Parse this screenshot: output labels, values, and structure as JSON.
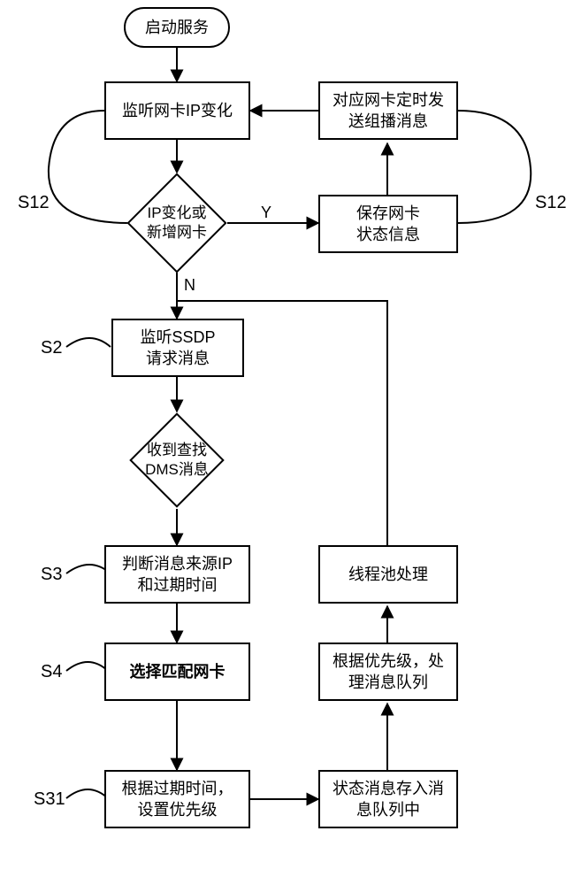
{
  "chart_data": {
    "type": "flowchart",
    "title": "",
    "nodes": [
      {
        "id": "start",
        "kind": "terminator",
        "label": "启动服务"
      },
      {
        "id": "p_listen_ip",
        "kind": "process",
        "label": "监听网卡IP变化",
        "tag": "S12"
      },
      {
        "id": "d_ip_change",
        "kind": "decision",
        "label": "IP变化或\n新增网卡"
      },
      {
        "id": "p_save_state",
        "kind": "process",
        "label": "保存网卡\n状态信息",
        "tag": "S12"
      },
      {
        "id": "p_timed_multicast",
        "kind": "process",
        "label": "对应网卡定时发\n送组播消息"
      },
      {
        "id": "p_listen_ssdp",
        "kind": "process",
        "label": "监听SSDP\n请求消息",
        "tag": "S2"
      },
      {
        "id": "d_recv_dms",
        "kind": "decision",
        "label": "收到查找\nDMS消息"
      },
      {
        "id": "p_judge",
        "kind": "process",
        "label": "判断消息来源IP\n和过期时间",
        "tag": "S3"
      },
      {
        "id": "p_select_nic",
        "kind": "process",
        "label": "选择匹配网卡",
        "tag": "S4",
        "bold": true
      },
      {
        "id": "p_set_priority",
        "kind": "process",
        "label": "根据过期时间，\n设置优先级",
        "tag": "S31"
      },
      {
        "id": "p_enqueue",
        "kind": "process",
        "label": "状态消息存入消\n息队列中"
      },
      {
        "id": "p_by_priority",
        "kind": "process",
        "label": "根据优先级，处\n理消息队列"
      },
      {
        "id": "p_threadpool",
        "kind": "process",
        "label": "线程池处理"
      }
    ],
    "edges": [
      {
        "from": "start",
        "to": "p_listen_ip"
      },
      {
        "from": "p_listen_ip",
        "to": "d_ip_change"
      },
      {
        "from": "d_ip_change",
        "to": "p_save_state",
        "label": "Y"
      },
      {
        "from": "d_ip_change",
        "to": "p_listen_ssdp",
        "label": "N"
      },
      {
        "from": "p_save_state",
        "to": "p_timed_multicast"
      },
      {
        "from": "p_timed_multicast",
        "to": "p_listen_ip"
      },
      {
        "from": "p_listen_ssdp",
        "to": "d_recv_dms"
      },
      {
        "from": "d_recv_dms",
        "to": "p_judge"
      },
      {
        "from": "p_judge",
        "to": "p_select_nic"
      },
      {
        "from": "p_select_nic",
        "to": "p_set_priority"
      },
      {
        "from": "p_set_priority",
        "to": "p_enqueue"
      },
      {
        "from": "p_enqueue",
        "to": "p_by_priority"
      },
      {
        "from": "p_by_priority",
        "to": "p_threadpool"
      },
      {
        "from": "p_threadpool",
        "to": "d_recv_dms_return"
      }
    ],
    "branch_labels": {
      "Y": "Y",
      "N": "N"
    }
  },
  "nodes": {
    "start": "启动服务",
    "listen_ip_l1": "监听网卡IP变化",
    "ip_change_l1": "IP变化或",
    "ip_change_l2": "新增网卡",
    "save_state_l1": "保存网卡",
    "save_state_l2": "状态信息",
    "timed_l1": "对应网卡定时发",
    "timed_l2": "送组播消息",
    "ssdp_l1": "监听SSDP",
    "ssdp_l2": "请求消息",
    "dms_l1": "收到查找",
    "dms_l2": "DMS消息",
    "judge_l1": "判断消息来源IP",
    "judge_l2": "和过期时间",
    "select_nic": "选择匹配网卡",
    "set_pri_l1": "根据过期时间，",
    "set_pri_l2": "设置优先级",
    "enqueue_l1": "状态消息存入消",
    "enqueue_l2": "息队列中",
    "by_pri_l1": "根据优先级，处",
    "by_pri_l2": "理消息队列",
    "threadpool": "线程池处理"
  },
  "tags": {
    "s12a": "S12",
    "s12b": "S12",
    "s2": "S2",
    "s3": "S3",
    "s4": "S4",
    "s31": "S31"
  },
  "labels": {
    "Y": "Y",
    "N": "N"
  }
}
